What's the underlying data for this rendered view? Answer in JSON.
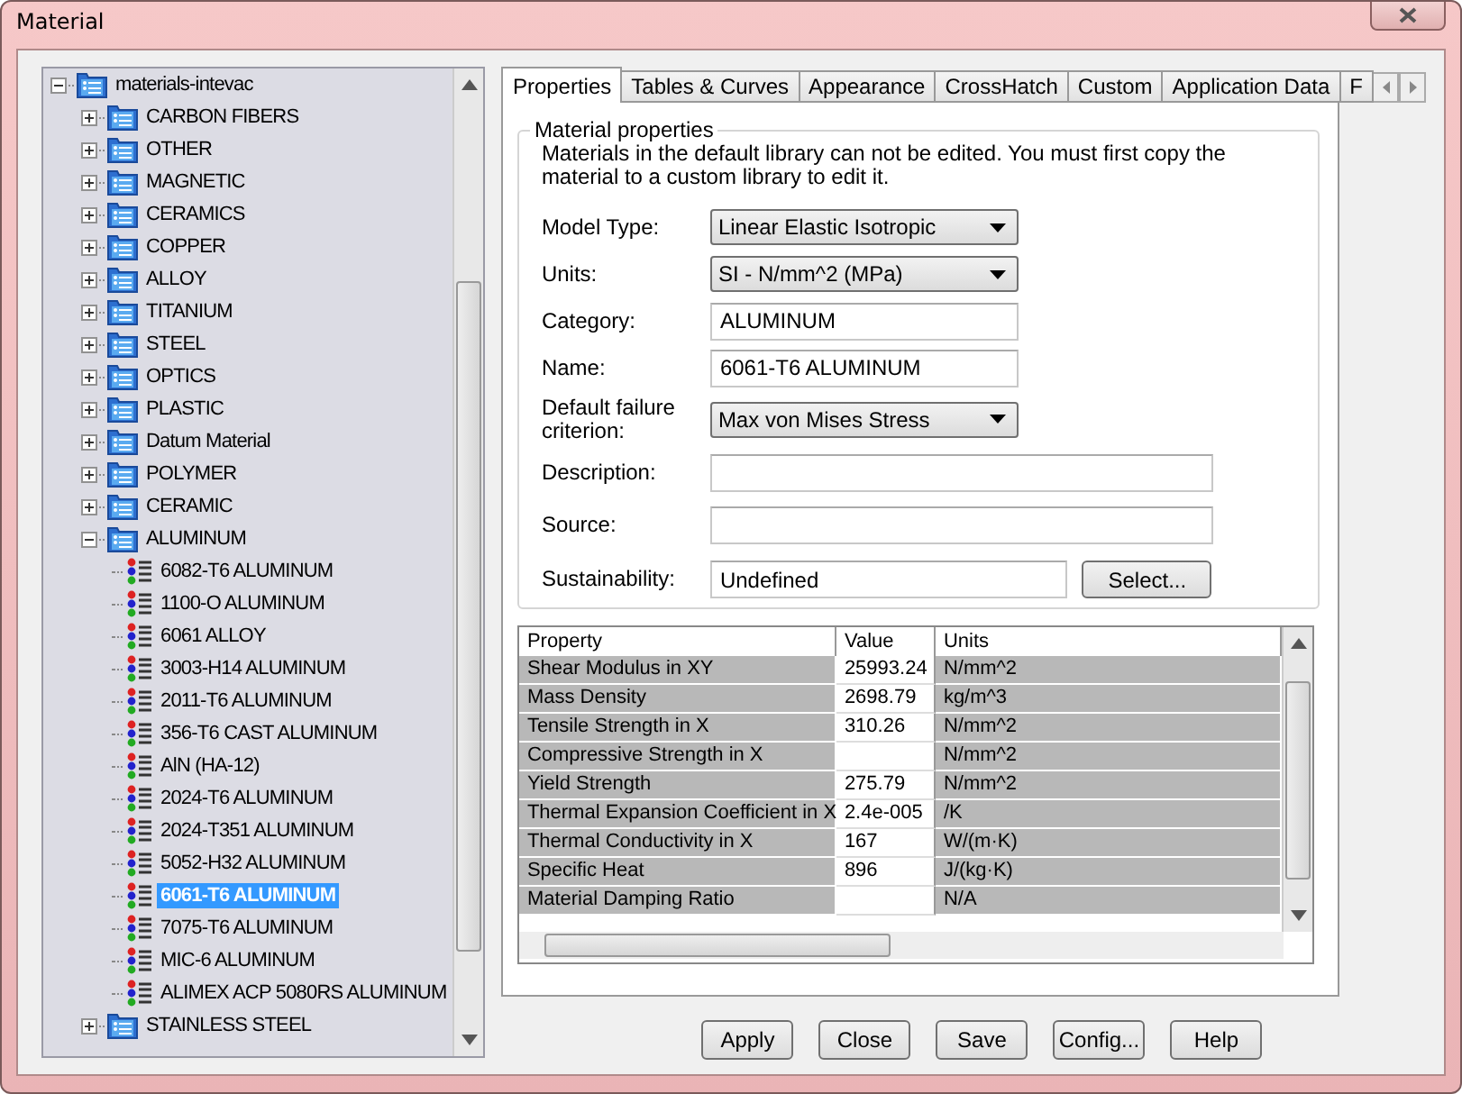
{
  "window": {
    "title": "Material"
  },
  "tree": {
    "label": "materials-intevac",
    "expanded": true,
    "children": [
      {
        "label": "CARBON FIBERS",
        "kind": "folder",
        "expanded": false
      },
      {
        "label": "OTHER",
        "kind": "folder",
        "expanded": false
      },
      {
        "label": "MAGNETIC",
        "kind": "folder",
        "expanded": false
      },
      {
        "label": "CERAMICS",
        "kind": "folder",
        "expanded": false
      },
      {
        "label": "COPPER",
        "kind": "folder",
        "expanded": false
      },
      {
        "label": "ALLOY",
        "kind": "folder",
        "expanded": false
      },
      {
        "label": "TITANIUM",
        "kind": "folder",
        "expanded": false
      },
      {
        "label": "STEEL",
        "kind": "folder",
        "expanded": false
      },
      {
        "label": "OPTICS",
        "kind": "folder",
        "expanded": false
      },
      {
        "label": "PLASTIC",
        "kind": "folder",
        "expanded": false
      },
      {
        "label": "Datum Material",
        "kind": "folder",
        "expanded": false
      },
      {
        "label": "POLYMER",
        "kind": "folder",
        "expanded": false
      },
      {
        "label": "CERAMIC",
        "kind": "folder",
        "expanded": false
      },
      {
        "label": "ALUMINUM",
        "kind": "folder",
        "expanded": true,
        "children": [
          {
            "label": "6082-T6 ALUMINUM",
            "kind": "material",
            "selected": false
          },
          {
            "label": "1100-O ALUMINUM",
            "kind": "material",
            "selected": false
          },
          {
            "label": "6061 ALLOY",
            "kind": "material",
            "selected": false
          },
          {
            "label": "3003-H14 ALUMINUM",
            "kind": "material",
            "selected": false
          },
          {
            "label": "2011-T6 ALUMINUM",
            "kind": "material",
            "selected": false
          },
          {
            "label": "356-T6 CAST ALUMINUM",
            "kind": "material",
            "selected": false
          },
          {
            "label": "AlN (HA-12)",
            "kind": "material",
            "selected": false
          },
          {
            "label": "2024-T6 ALUMINUM",
            "kind": "material",
            "selected": false
          },
          {
            "label": "2024-T351 ALUMINUM",
            "kind": "material",
            "selected": false
          },
          {
            "label": "5052-H32 ALUMINUM",
            "kind": "material",
            "selected": false
          },
          {
            "label": "6061-T6 ALUMINUM",
            "kind": "material",
            "selected": true
          },
          {
            "label": "7075-T6 ALUMINUM",
            "kind": "material",
            "selected": false
          },
          {
            "label": "MIC-6 ALUMINUM",
            "kind": "material",
            "selected": false
          },
          {
            "label": "ALIMEX ACP 5080RS ALUMINUM",
            "kind": "material",
            "selected": false
          }
        ]
      },
      {
        "label": "STAINLESS STEEL",
        "kind": "folder",
        "expanded": false
      }
    ]
  },
  "tabs": [
    {
      "label": "Properties",
      "selected": true
    },
    {
      "label": "Tables & Curves",
      "selected": false
    },
    {
      "label": "Appearance",
      "selected": false
    },
    {
      "label": "CrossHatch",
      "selected": false
    },
    {
      "label": "Custom",
      "selected": false
    },
    {
      "label": "Application Data",
      "selected": false
    },
    {
      "label": "F",
      "selected": false
    }
  ],
  "material_properties": {
    "title": "Material properties",
    "note": "Materials in the default library can not be edited. You must first copy the material to a custom library to edit it.",
    "fields": [
      {
        "label": "Model Type:",
        "kind": "dropdown",
        "value": "Linear Elastic Isotropic"
      },
      {
        "label": "Units:",
        "kind": "dropdown",
        "value": "SI - N/mm^2 (MPa)"
      },
      {
        "label": "Category:",
        "kind": "text",
        "value": "ALUMINUM"
      },
      {
        "label": "Name:",
        "kind": "text",
        "value": "6061-T6 ALUMINUM"
      },
      {
        "label": "Default failure criterion:",
        "kind": "dropdown",
        "value": "Max von Mises Stress"
      },
      {
        "label": "Description:",
        "kind": "wide"
      },
      {
        "label": "Source:",
        "kind": "wide"
      },
      {
        "label": "Sustainability:",
        "kind": "select",
        "value": "Undefined",
        "button": "Select..."
      }
    ]
  },
  "table": {
    "columns": [
      "Property",
      "Value",
      "Units"
    ],
    "rows": [
      {
        "property": "Shear Modulus in XY",
        "value": "25993.24",
        "units": "N/mm^2"
      },
      {
        "property": "Mass Density",
        "value": "2698.79",
        "units": "kg/m^3"
      },
      {
        "property": "Tensile Strength in X",
        "value": "310.26",
        "units": "N/mm^2"
      },
      {
        "property": "Compressive Strength in X",
        "units": "N/mm^2"
      },
      {
        "property": "Yield Strength",
        "value": "275.79",
        "units": "N/mm^2"
      },
      {
        "property": "Thermal Expansion Coefficient in X",
        "value": "2.4e-005",
        "units": "/K"
      },
      {
        "property": "Thermal Conductivity in X",
        "value": "167",
        "units": "W/(m·K)"
      },
      {
        "property": "Specific Heat",
        "value": "896",
        "units": "J/(kg·K)"
      },
      {
        "property": "Material Damping Ratio",
        "units": "N/A"
      }
    ]
  },
  "buttons": [
    "Apply",
    "Close",
    "Save",
    "Config...",
    "Help"
  ]
}
